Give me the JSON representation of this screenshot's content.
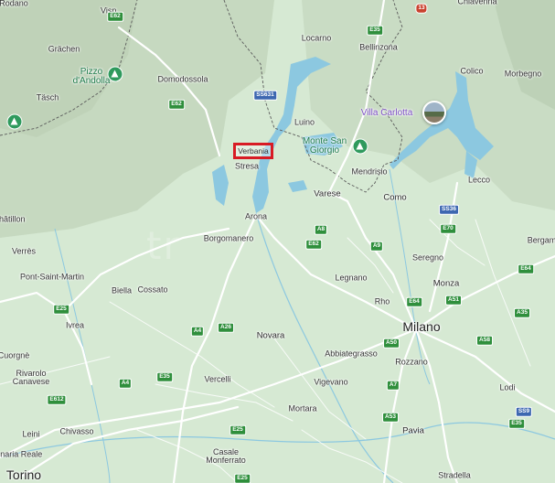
{
  "map": {
    "highlighted_place": "Verbania",
    "watermark": "tr",
    "colors": {
      "land": "#d6e9d3",
      "mountain": "#c9dcc4",
      "water": "#8cc8e0",
      "road": "#ffffff",
      "border": "#5a5a5a",
      "highlight": "#d81b24",
      "park_pin": "#2f9a5d",
      "poi": "#7c4ec4"
    },
    "labels": [
      {
        "text": "Visp",
        "kind": "town"
      },
      {
        "text": "Grächen",
        "kind": "town"
      },
      {
        "text": "Täsch",
        "kind": "town"
      },
      {
        "text": "Pizzo d'Andolla",
        "kind": "park"
      },
      {
        "text": "Domodossola",
        "kind": "town"
      },
      {
        "text": "Locarno",
        "kind": "town"
      },
      {
        "text": "Bellinzona",
        "kind": "town"
      },
      {
        "text": "Chiavenna",
        "kind": "town"
      },
      {
        "text": "Colico",
        "kind": "town"
      },
      {
        "text": "Morbegno",
        "kind": "town"
      },
      {
        "text": "Villa Carlotta",
        "kind": "poi"
      },
      {
        "text": "Luino",
        "kind": "town"
      },
      {
        "text": "Monte San Giorgio",
        "kind": "park"
      },
      {
        "text": "Mendrisio",
        "kind": "town"
      },
      {
        "text": "Stresa",
        "kind": "town"
      },
      {
        "text": "Varese",
        "kind": "city"
      },
      {
        "text": "Como",
        "kind": "city"
      },
      {
        "text": "Lecco",
        "kind": "town"
      },
      {
        "text": "Arona",
        "kind": "town"
      },
      {
        "text": "Borgomanero",
        "kind": "town"
      },
      {
        "text": "Châtillon",
        "kind": "town"
      },
      {
        "text": "Verrès",
        "kind": "town"
      },
      {
        "text": "Pont-Saint-Martin",
        "kind": "town"
      },
      {
        "text": "Biella",
        "kind": "town"
      },
      {
        "text": "Cossato",
        "kind": "town"
      },
      {
        "text": "Legnano",
        "kind": "town"
      },
      {
        "text": "Seregno",
        "kind": "town"
      },
      {
        "text": "Monza",
        "kind": "city"
      },
      {
        "text": "Rho",
        "kind": "town"
      },
      {
        "text": "Milano",
        "kind": "big"
      },
      {
        "text": "Bergamo",
        "kind": "town"
      },
      {
        "text": "Ivrea",
        "kind": "town"
      },
      {
        "text": "Novara",
        "kind": "city"
      },
      {
        "text": "Abbiategrasso",
        "kind": "town"
      },
      {
        "text": "Rozzano",
        "kind": "town"
      },
      {
        "text": "Cuorgnè",
        "kind": "town"
      },
      {
        "text": "Rivarolo Canavese",
        "kind": "town"
      },
      {
        "text": "Vercelli",
        "kind": "town"
      },
      {
        "text": "Vigevano",
        "kind": "town"
      },
      {
        "text": "Lodi",
        "kind": "town"
      },
      {
        "text": "Mortara",
        "kind": "town"
      },
      {
        "text": "Leini",
        "kind": "town"
      },
      {
        "text": "Chivasso",
        "kind": "town"
      },
      {
        "text": "Pavia",
        "kind": "city"
      },
      {
        "text": "Venaria Reale",
        "kind": "town"
      },
      {
        "text": "Casale Monferrato",
        "kind": "town"
      },
      {
        "text": "Torino",
        "kind": "big"
      },
      {
        "text": "Stradella",
        "kind": "town"
      },
      {
        "text": "Rodano",
        "kind": "town"
      }
    ],
    "road_shields": [
      {
        "ref": "E62",
        "color": "green"
      },
      {
        "ref": "E35",
        "color": "green"
      },
      {
        "ref": "13",
        "color": "red"
      },
      {
        "ref": "E62",
        "color": "green"
      },
      {
        "ref": "SS631",
        "color": "blue"
      },
      {
        "ref": "A8",
        "color": "green"
      },
      {
        "ref": "E62",
        "color": "green"
      },
      {
        "ref": "A9",
        "color": "green"
      },
      {
        "ref": "SS36",
        "color": "blue"
      },
      {
        "ref": "E64",
        "color": "green"
      },
      {
        "ref": "E64",
        "color": "green"
      },
      {
        "ref": "A51",
        "color": "green"
      },
      {
        "ref": "A35",
        "color": "green"
      },
      {
        "ref": "E25",
        "color": "green"
      },
      {
        "ref": "A4",
        "color": "green"
      },
      {
        "ref": "A26",
        "color": "green"
      },
      {
        "ref": "A50",
        "color": "green"
      },
      {
        "ref": "A58",
        "color": "green"
      },
      {
        "ref": "A4",
        "color": "green"
      },
      {
        "ref": "E35",
        "color": "green"
      },
      {
        "ref": "A7",
        "color": "green"
      },
      {
        "ref": "E612",
        "color": "green"
      },
      {
        "ref": "A53",
        "color": "green"
      },
      {
        "ref": "SS9",
        "color": "blue"
      },
      {
        "ref": "E35",
        "color": "green"
      },
      {
        "ref": "E25",
        "color": "green"
      },
      {
        "ref": "E25",
        "color": "green"
      },
      {
        "ref": "E70",
        "color": "green"
      }
    ]
  }
}
